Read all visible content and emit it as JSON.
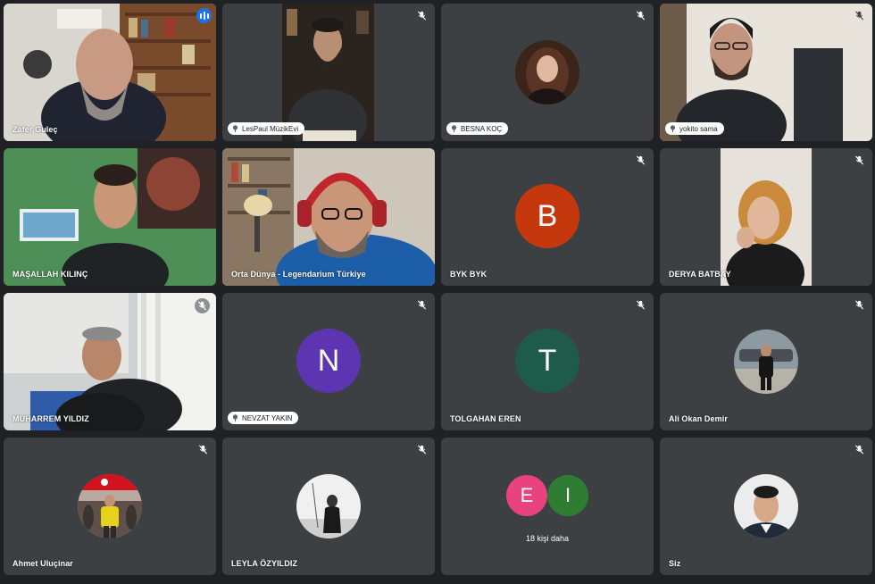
{
  "colors": {
    "background": "#202124",
    "tile": "#3c4043",
    "active_outline": "#8ab4f8",
    "speaking": "#1a73e8"
  },
  "participants": [
    {
      "name": "Zafer Guleç",
      "speaking": true
    },
    {
      "name": "LesPaul MüzikEvi",
      "pinnable": true,
      "muted": true
    },
    {
      "name": "BESNA KOÇ",
      "pinnable": true,
      "muted": true
    },
    {
      "name": "yokito sama",
      "pinnable": true,
      "muted": true
    },
    {
      "name": "MAŞALLAH KILINÇ"
    },
    {
      "name": "Orta Dünya - Legendarium Türkiye"
    },
    {
      "name": "BYK BYK",
      "letter": "B",
      "color": "#c5380d",
      "muted": true
    },
    {
      "name": "DERYA BATBAY",
      "muted": true
    },
    {
      "name": "MUHARREM YILDIZ",
      "muted": true
    },
    {
      "name": "NEVZAT YAKIN",
      "letter": "N",
      "color": "#5e35b1",
      "pinnable": true,
      "muted": true
    },
    {
      "name": "TOLGAHAN EREN",
      "letter": "T",
      "color": "#1e5b4b",
      "muted": true
    },
    {
      "name": "Ali Okan Demir",
      "muted": true
    },
    {
      "name": "Ahmet Uluçinar",
      "muted": true
    },
    {
      "name": "LEYLA ÖZYILDIZ",
      "muted": true
    },
    {
      "overflow_letters": [
        "E",
        "I"
      ],
      "overflow_colors": [
        "#e8437d",
        "#2e7d32"
      ],
      "overflow_label": "18 kişi daha"
    },
    {
      "name": "Siz",
      "muted": true
    }
  ]
}
